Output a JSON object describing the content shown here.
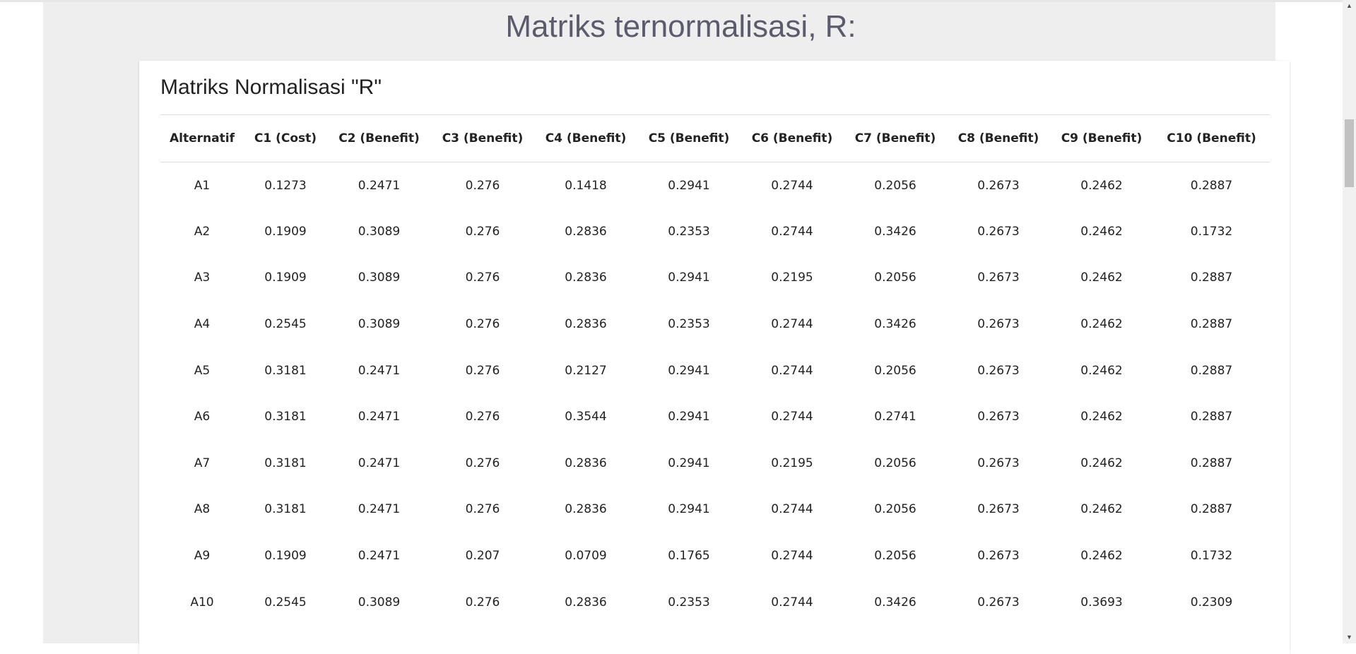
{
  "page": {
    "heading": "Matriks ternormalisasi, R:"
  },
  "card": {
    "title": "Matriks Normalisasi \"R\""
  },
  "table": {
    "headers": [
      "Alternatif",
      "C1 (Cost)",
      "C2 (Benefit)",
      "C3 (Benefit)",
      "C4 (Benefit)",
      "C5 (Benefit)",
      "C6 (Benefit)",
      "C7 (Benefit)",
      "C8 (Benefit)",
      "C9 (Benefit)",
      "C10 (Benefit)"
    ],
    "rows": [
      [
        "A1",
        "0.1273",
        "0.2471",
        "0.276",
        "0.1418",
        "0.2941",
        "0.2744",
        "0.2056",
        "0.2673",
        "0.2462",
        "0.2887"
      ],
      [
        "A2",
        "0.1909",
        "0.3089",
        "0.276",
        "0.2836",
        "0.2353",
        "0.2744",
        "0.3426",
        "0.2673",
        "0.2462",
        "0.1732"
      ],
      [
        "A3",
        "0.1909",
        "0.3089",
        "0.276",
        "0.2836",
        "0.2941",
        "0.2195",
        "0.2056",
        "0.2673",
        "0.2462",
        "0.2887"
      ],
      [
        "A4",
        "0.2545",
        "0.3089",
        "0.276",
        "0.2836",
        "0.2353",
        "0.2744",
        "0.3426",
        "0.2673",
        "0.2462",
        "0.2887"
      ],
      [
        "A5",
        "0.3181",
        "0.2471",
        "0.276",
        "0.2127",
        "0.2941",
        "0.2744",
        "0.2056",
        "0.2673",
        "0.2462",
        "0.2887"
      ],
      [
        "A6",
        "0.3181",
        "0.2471",
        "0.276",
        "0.3544",
        "0.2941",
        "0.2744",
        "0.2741",
        "0.2673",
        "0.2462",
        "0.2887"
      ],
      [
        "A7",
        "0.3181",
        "0.2471",
        "0.276",
        "0.2836",
        "0.2941",
        "0.2195",
        "0.2056",
        "0.2673",
        "0.2462",
        "0.2887"
      ],
      [
        "A8",
        "0.3181",
        "0.2471",
        "0.276",
        "0.2836",
        "0.2941",
        "0.2744",
        "0.2056",
        "0.2673",
        "0.2462",
        "0.2887"
      ],
      [
        "A9",
        "0.1909",
        "0.2471",
        "0.207",
        "0.0709",
        "0.1765",
        "0.2744",
        "0.2056",
        "0.2673",
        "0.2462",
        "0.1732"
      ],
      [
        "A10",
        "0.2545",
        "0.3089",
        "0.276",
        "0.2836",
        "0.2353",
        "0.2744",
        "0.3426",
        "0.2673",
        "0.3693",
        "0.2309"
      ]
    ]
  },
  "scrollbar": {
    "up_icon": "▲",
    "down_icon": "▼"
  }
}
